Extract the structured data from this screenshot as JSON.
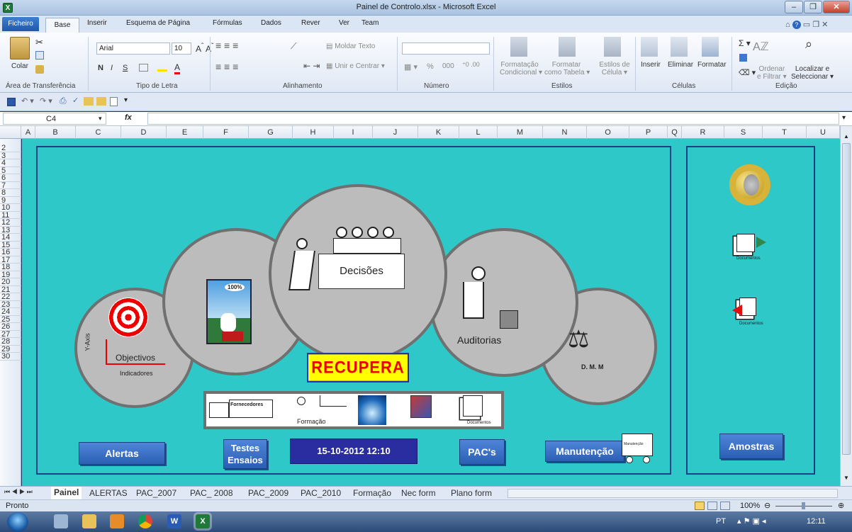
{
  "window": {
    "title": "Painel de Controlo.xlsx - Microsoft Excel",
    "min": "–",
    "max": "❐",
    "close": "✕"
  },
  "ribbon_tabs": [
    "Base",
    "Inserir",
    "Esquema de Página",
    "Fórmulas",
    "Dados",
    "Rever",
    "Ver",
    "Team"
  ],
  "file_tab": "Ficheiro",
  "ribbon": {
    "clipboard": {
      "label": "Área de Transferência",
      "paste": "Colar"
    },
    "font": {
      "label": "Tipo de Letra",
      "name": "Arial",
      "size": "10",
      "bold": "N",
      "italic": "I",
      "underline": "S"
    },
    "alignment": {
      "label": "Alinhamento",
      "wrap": "Moldar Texto",
      "merge": "Unir e Centrar"
    },
    "number": {
      "label": "Número",
      "format": "",
      "percent": "%",
      "thousands": "000"
    },
    "styles": {
      "label": "Estilos",
      "conditional1": "Formatação",
      "conditional2": "Condicional",
      "table1": "Formatar",
      "table2": "como Tabela",
      "cell1": "Estilos de",
      "cell2": "Célula"
    },
    "cells": {
      "label": "Células",
      "insert": "Inserir",
      "delete": "Eliminar",
      "format": "Formatar"
    },
    "editing": {
      "label": "Edição",
      "sort1": "Ordenar",
      "sort2": "e Filtrar",
      "find1": "Localizar e",
      "find2": "Seleccionar"
    }
  },
  "formula_bar": {
    "cell_ref": "C4",
    "fx": "fx",
    "value": ""
  },
  "columns": [
    "A",
    "B",
    "C",
    "D",
    "E",
    "F",
    "G",
    "H",
    "I",
    "J",
    "K",
    "L",
    "M",
    "N",
    "O",
    "P",
    "Q",
    "R",
    "S",
    "T",
    "U"
  ],
  "rows": [
    "2",
    "3",
    "4",
    "5",
    "6",
    "7",
    "8",
    "9",
    "10",
    "11",
    "12",
    "13",
    "14",
    "15",
    "16",
    "17",
    "18",
    "19",
    "20",
    "21",
    "22",
    "23",
    "24",
    "25",
    "26",
    "27",
    "28",
    "29",
    "30"
  ],
  "dashboard": {
    "decisions": "Decisões",
    "audits": "Auditorias",
    "objectives": "Objectivos",
    "y_axis": "Y-Axis",
    "indicators": "Indicadores",
    "dmm": "D. M. M",
    "hundred": "100%",
    "recupera": "RECUPERA",
    "suppliers": "Fornecedores",
    "training": "Formação",
    "documents": "Documentos",
    "maintenance_sign": "Manutenção",
    "buttons": {
      "alerts": "Alertas",
      "tests1": "Testes",
      "tests2": "Ensaios",
      "datetime": "15-10-2012 12:10",
      "pacs": "PAC's",
      "maintenance": "Manutenção",
      "samples": "Amostras"
    }
  },
  "sheet_tabs": [
    "Painel",
    "ALERTAS",
    "PAC_2007",
    "PAC_ 2008",
    "PAC_2009",
    "PAC_2010",
    "Formação",
    "Nec form",
    "Plano form"
  ],
  "status": {
    "ready": "Pronto",
    "zoom": "100%"
  },
  "taskbar": {
    "lang": "PT",
    "time": "12:11"
  }
}
